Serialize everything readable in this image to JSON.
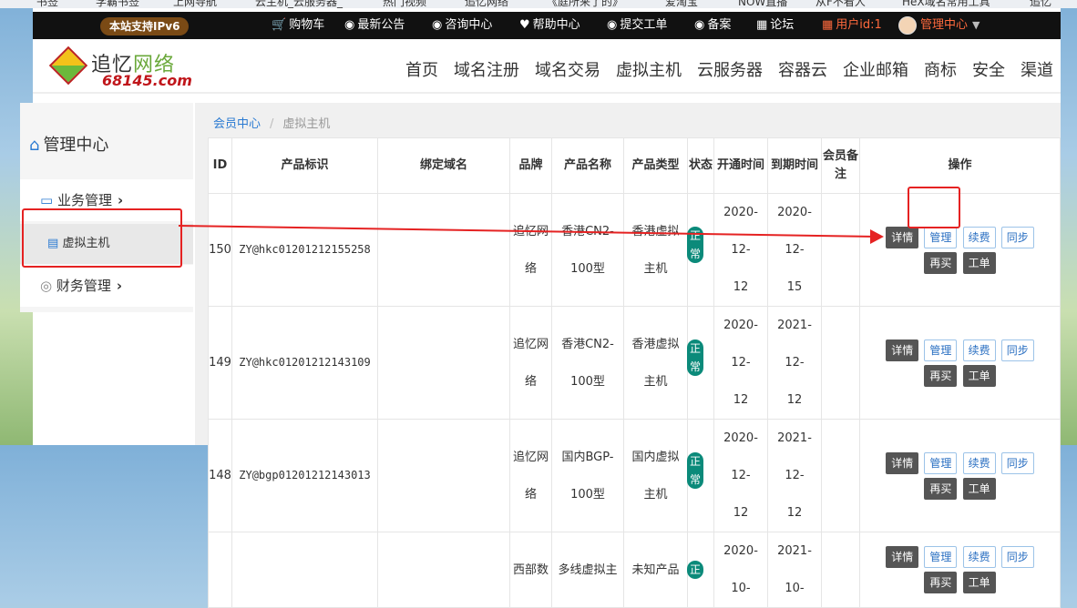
{
  "browser": {
    "bookmarks": [
      "书签",
      "学霸书签",
      "上网导航",
      "云主机_云服务器_",
      "热门视频",
      "追忆网络",
      "《庭所来了的》",
      "爱淘宝",
      "NOW直播",
      "从F不看人",
      "HeX域名常用工具",
      "追忆"
    ]
  },
  "topbar": {
    "ipv6_badge": "本站支持IPv6",
    "links": [
      {
        "icon": "cart-icon",
        "label": "购物车"
      },
      {
        "icon": "globe-icon",
        "label": "最新公告"
      },
      {
        "icon": "globe-icon",
        "label": "咨询中心"
      },
      {
        "icon": "heart-icon",
        "label": "帮助中心"
      },
      {
        "icon": "globe-icon",
        "label": "提交工单"
      },
      {
        "icon": "globe-icon",
        "label": "备案"
      },
      {
        "icon": "grid-icon",
        "label": "论坛"
      }
    ],
    "user_id": "用户id:1",
    "member_center": "管理中心"
  },
  "logo": {
    "cn_1": "追忆",
    "cn_2": "网络",
    "domain": "68145.com"
  },
  "nav": [
    "首页",
    "域名注册",
    "域名交易",
    "虚拟主机",
    "云服务器",
    "容器云",
    "企业邮箱",
    "商标",
    "安全",
    "渠道"
  ],
  "sidebar": {
    "title": "管理中心",
    "business": "业务管理",
    "virtual_host": "虚拟主机",
    "finance": "财务管理"
  },
  "breadcrumb": {
    "root": "会员中心",
    "current": "虚拟主机"
  },
  "table": {
    "headers": {
      "id": "ID",
      "product_id": "产品标识",
      "domain": "绑定域名",
      "brand": "品牌",
      "product_name": "产品名称",
      "product_type": "产品类型",
      "status": "状态",
      "open_time": "开通时间",
      "expire_time": "到期时间",
      "remark_1": "会员备",
      "remark_2": "注",
      "actions": "操作"
    },
    "rows": [
      {
        "id": "150",
        "ident": "ZY@hkc01201212155258",
        "domain": "",
        "brand_1": "追忆网",
        "brand_2": "络",
        "name_1": "香港CN2-",
        "name_2": "100型",
        "type_1": "香港虚拟",
        "type_2": "主机",
        "status_1": "正",
        "status_2": "常",
        "open_1": "2020-12-",
        "open_2": "12",
        "exp_1": "2020-12-",
        "exp_2": "15",
        "remark": ""
      },
      {
        "id": "149",
        "ident": "ZY@hkc01201212143109",
        "domain": "",
        "brand_1": "追忆网",
        "brand_2": "络",
        "name_1": "香港CN2-",
        "name_2": "100型",
        "type_1": "香港虚拟",
        "type_2": "主机",
        "status_1": "正",
        "status_2": "常",
        "open_1": "2020-12-",
        "open_2": "12",
        "exp_1": "2021-12-",
        "exp_2": "12",
        "remark": ""
      },
      {
        "id": "148",
        "ident": "ZY@bgp01201212143013",
        "domain": "",
        "brand_1": "追忆网",
        "brand_2": "络",
        "name_1": "国内BGP-",
        "name_2": "100型",
        "type_1": "国内虚拟",
        "type_2": "主机",
        "status_1": "正",
        "status_2": "常",
        "open_1": "2020-12-",
        "open_2": "12",
        "exp_1": "2021-12-",
        "exp_2": "12",
        "remark": ""
      },
      {
        "id": "",
        "ident": "",
        "domain": "",
        "brand_1": "西部数",
        "brand_2": "",
        "name_1": "多线虚拟主",
        "name_2": "",
        "type_1": "未知产品",
        "type_2": "",
        "status_1": "正",
        "status_2": "",
        "open_1": "2020-10-",
        "open_2": "",
        "exp_1": "2021-10-",
        "exp_2": "",
        "remark": ""
      }
    ],
    "actions": {
      "detail": "详情",
      "manage": "管理",
      "renew": "续费",
      "sync": "同步",
      "rebuy": "再买",
      "ticket": "工单"
    }
  },
  "colors": {
    "accent_blue": "#2a7ad2",
    "annotation_red": "#e52222",
    "status_green": "#0b8a7a",
    "topbar_bg": "#111111"
  }
}
